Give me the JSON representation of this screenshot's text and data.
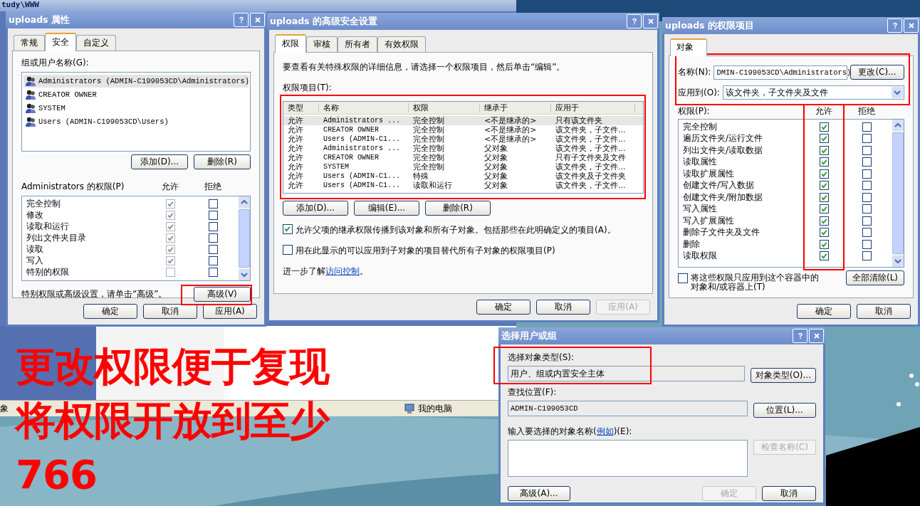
{
  "background": {
    "window_title": "tudy\\WWW",
    "status_bar": [
      "象",
      "我的电脑"
    ]
  },
  "properties_dialog": {
    "title": "uploads 属性",
    "tabs": [
      {
        "label": "常规",
        "selected": false
      },
      {
        "label": "安全",
        "selected": true
      },
      {
        "label": "自定义",
        "selected": false
      }
    ],
    "users_label": "组或用户名称(G):",
    "users": [
      {
        "name": "Administrators (ADMIN-C199053CD\\Administrators)",
        "selected": true
      },
      {
        "name": "CREATOR OWNER",
        "selected": false
      },
      {
        "name": "SYSTEM",
        "selected": false
      },
      {
        "name": "Users (ADMIN-C199053CD\\Users)",
        "selected": false
      }
    ],
    "user_buttons": [
      "添加(D)...",
      "删除(R)"
    ],
    "permissions_label": "Administrators 的权限(P)",
    "allow_label": "允许",
    "deny_label": "拒绝",
    "permissions": [
      {
        "name": "完全控制",
        "allow": true,
        "allow_disabled": true,
        "deny": false
      },
      {
        "name": "修改",
        "allow": true,
        "allow_disabled": true,
        "deny": false
      },
      {
        "name": "读取和运行",
        "allow": true,
        "allow_disabled": true,
        "deny": false
      },
      {
        "name": "列出文件夹目录",
        "allow": true,
        "allow_disabled": true,
        "deny": false
      },
      {
        "name": "读取",
        "allow": true,
        "allow_disabled": true,
        "deny": false
      },
      {
        "name": "写入",
        "allow": true,
        "allow_disabled": true,
        "deny": false
      },
      {
        "name": "特别的权限",
        "allow": false,
        "allow_disabled": true,
        "deny": false
      }
    ],
    "advanced_note": "特别权限或高级设置，请单击“高级”。",
    "advanced_button": "高级(V)",
    "footer_buttons": [
      {
        "label": "确定",
        "disabled": false
      },
      {
        "label": "取消",
        "disabled": false
      },
      {
        "label": "应用(A)",
        "disabled": false
      }
    ]
  },
  "advanced_dialog": {
    "title": "uploads 的高级安全设置",
    "tabs": [
      {
        "label": "权限",
        "selected": true
      },
      {
        "label": "审核",
        "selected": false
      },
      {
        "label": "所有者",
        "selected": false
      },
      {
        "label": "有效权限",
        "selected": false
      }
    ],
    "intro": "要查看有关特殊权限的详细信息，请选择一个权限项目，然后单击“编辑”。",
    "entries_label": "权限项目(T):",
    "columns": [
      "类型",
      "名称",
      "权限",
      "继承于",
      "应用于"
    ],
    "rows": [
      {
        "cells": [
          "允许",
          "Administrators ...",
          "完全控制",
          "<不是继承的>",
          "只有该文件夹"
        ],
        "selected": true
      },
      {
        "cells": [
          "允许",
          "CREATOR OWNER",
          "完全控制",
          "<不是继承的>",
          "该文件夹，子文件..."
        ],
        "selected": false
      },
      {
        "cells": [
          "允许",
          "Users (ADMIN-C1...",
          "完全控制",
          "<不是继承的>",
          "该文件夹，子文件..."
        ],
        "selected": false
      },
      {
        "cells": [
          "允许",
          "Administrators ...",
          "完全控制",
          "父对象",
          "该文件夹，子文件..."
        ],
        "selected": false
      },
      {
        "cells": [
          "允许",
          "CREATOR OWNER",
          "完全控制",
          "父对象",
          "只有子文件夹及文件"
        ],
        "selected": false
      },
      {
        "cells": [
          "允许",
          "SYSTEM",
          "完全控制",
          "父对象",
          "该文件夹，子文件..."
        ],
        "selected": false
      },
      {
        "cells": [
          "允许",
          "Users (ADMIN-C1...",
          "特殊",
          "父对象",
          "该文件夹及子文件夹"
        ],
        "selected": false
      },
      {
        "cells": [
          "允许",
          "Users (ADMIN-C1...",
          "读取和运行",
          "父对象",
          "该文件夹，子文件..."
        ],
        "selected": false
      }
    ],
    "entry_buttons": [
      "添加(D)...",
      "编辑(E)...",
      "删除(R)"
    ],
    "options": [
      {
        "label": "允许父项的继承权限传播到该对象和所有子对象。包括那些在此明确定义的项目(A)。",
        "checked": true
      },
      {
        "label": "用在此显示的可以应用到子对象的项目替代所有子对象的权限项目(P)",
        "checked": false
      }
    ],
    "learn_text": "进一步了解",
    "learn_link": "访问控制",
    "learn_end": "。",
    "footer_buttons": [
      {
        "label": "确定",
        "disabled": false
      },
      {
        "label": "取消",
        "disabled": false
      },
      {
        "label": "应用(A)",
        "disabled": true
      }
    ]
  },
  "entry_dialog": {
    "title": "uploads 的权限项目",
    "tabs": [
      {
        "label": "对象",
        "selected": true
      }
    ],
    "name_label": "名称(N):",
    "name_value": "DMIN-C199053CD\\Administrators)",
    "change_button": "更改(C)...",
    "apply_label": "应用到(O):",
    "apply_value": "该文件夹，子文件夹及文件",
    "permissions_label": "权限(P):",
    "allow_label": "允许",
    "deny_label": "拒绝",
    "permissions": [
      {
        "name": "完全控制",
        "allow": true,
        "deny": false
      },
      {
        "name": "遍历文件夹/运行文件",
        "allow": true,
        "deny": false
      },
      {
        "name": "列出文件夹/读取数据",
        "allow": true,
        "deny": false
      },
      {
        "name": "读取属性",
        "allow": true,
        "deny": false
      },
      {
        "name": "读取扩展属性",
        "allow": true,
        "deny": false
      },
      {
        "name": "创建文件/写入数据",
        "allow": true,
        "deny": false
      },
      {
        "name": "创建文件夹/附加数据",
        "allow": true,
        "deny": false
      },
      {
        "name": "写入属性",
        "allow": true,
        "deny": false
      },
      {
        "name": "写入扩展属性",
        "allow": true,
        "deny": false
      },
      {
        "name": "删除子文件夹及文件",
        "allow": true,
        "deny": false
      },
      {
        "name": "删除",
        "allow": true,
        "deny": false
      },
      {
        "name": "读取权限",
        "allow": true,
        "deny": false
      }
    ],
    "container_option": {
      "label": "将这些权限只应用到这个容器中的对象和/或容器上(T)",
      "checked": false
    },
    "clear_button": "全部清除(L)",
    "footer_buttons": [
      {
        "label": "确定",
        "disabled": false
      },
      {
        "label": "取消",
        "disabled": false
      }
    ]
  },
  "select_dialog": {
    "title": "选择用户或组",
    "type_label": "选择对象类型(S):",
    "type_value": "用户、组或内置安全主体",
    "type_button": "对象类型(O)...",
    "location_label": "查找位置(F):",
    "location_value": "ADMIN-C199053CD",
    "location_button": "位置(L)...",
    "names_label": "输入要选择的对象名称(",
    "names_link": "例如",
    "names_label_end": ")(E):",
    "check_button": {
      "label": "检查名称(C)",
      "disabled": true
    },
    "advanced_button": "高级(A)...",
    "footer_buttons": [
      {
        "label": "确定",
        "disabled": true
      },
      {
        "label": "取消",
        "disabled": false
      }
    ]
  },
  "annotation": {
    "lines": [
      "更改权限便于复现",
      "将权限开放到至少",
      "766"
    ]
  }
}
